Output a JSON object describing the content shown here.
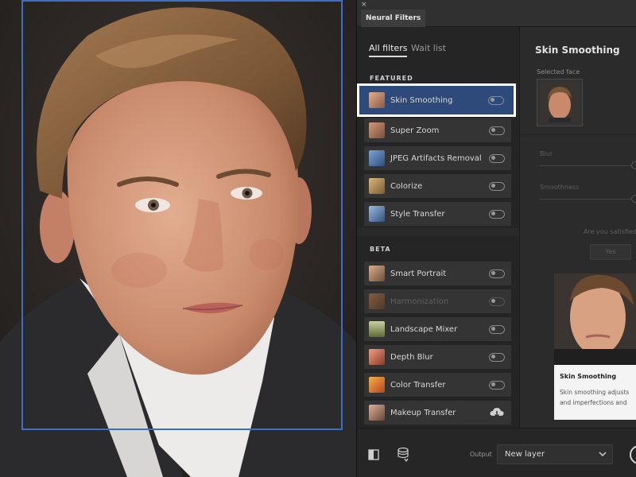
{
  "window": {
    "close_glyph": "×",
    "tab_title": "Neural Filters"
  },
  "filters_panel": {
    "tabs": [
      "All filters",
      "Wait list"
    ],
    "featured_label": "FEATURED",
    "beta_label": "BETA",
    "featured": [
      {
        "label": "Skin Smoothing",
        "thumb_color": "#a87a5f",
        "selected": true,
        "control": "toggle"
      },
      {
        "label": "Super Zoom",
        "thumb_color": "#9a6a52",
        "selected": false,
        "control": "toggle"
      },
      {
        "label": "JPEG Artifacts Removal",
        "thumb_color": "#4b72a8",
        "selected": false,
        "control": "toggle"
      },
      {
        "label": "Colorize",
        "thumb_color": "#b38d55",
        "selected": false,
        "control": "toggle"
      },
      {
        "label": "Style Transfer",
        "thumb_color": "#5b7fa8",
        "selected": false,
        "control": "toggle"
      }
    ],
    "beta": [
      {
        "label": "Smart Portrait",
        "thumb_color": "#a8846a",
        "dimmed": false,
        "control": "toggle"
      },
      {
        "label": "Harmonization",
        "thumb_color": "#b06a3a",
        "dimmed": true,
        "control": "toggle"
      },
      {
        "label": "Landscape Mixer",
        "thumb_color": "#8e9a5a",
        "dimmed": false,
        "control": "toggle"
      },
      {
        "label": "Depth Blur",
        "thumb_color": "#c46a52",
        "dimmed": false,
        "control": "toggle"
      },
      {
        "label": "Color Transfer",
        "thumb_color": "#d3782c",
        "dimmed": false,
        "control": "toggle"
      },
      {
        "label": "Makeup Transfer",
        "thumb_color": "#9c7560",
        "dimmed": false,
        "control": "cloud-download"
      }
    ]
  },
  "settings": {
    "title": "Skin Smoothing",
    "selected_face_label": "Selected face",
    "sliders": [
      {
        "label": "Blur"
      },
      {
        "label": "Smoothness"
      }
    ],
    "satisfied_text": "Are you satisfied",
    "yes_label": "Yes"
  },
  "info_card": {
    "title": "Skin Smoothing",
    "description": "Skin smoothing adjusts and imperfections and acne fro"
  },
  "footer": {
    "output_label": "Output",
    "output_value": "New layer"
  },
  "colors": {
    "selection_border": "#ffffff",
    "selected_row": "#2d4a7a",
    "face_box": "#3a6fc4",
    "panel_bg": "#2a2a2a"
  }
}
